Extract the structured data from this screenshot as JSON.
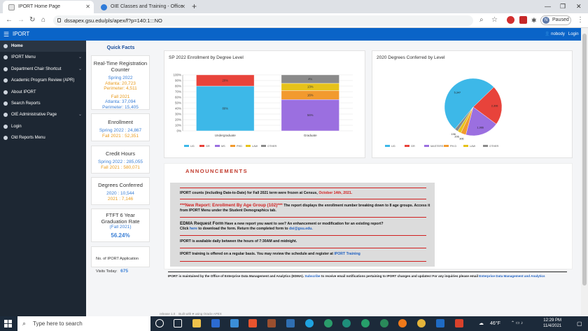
{
  "browser": {
    "tabs": [
      {
        "title": "IPORT Home Page",
        "active": true
      },
      {
        "title": "OIE Classes and Training - Office",
        "active": false
      }
    ],
    "new_tab": "+",
    "window_controls": [
      "—",
      "❐",
      "✕"
    ],
    "url": "dssapex.gsu.edu/pls/apex/f?p=140:1:::NO",
    "profile_initial": "N",
    "profile_status": "Paused"
  },
  "app": {
    "brand": "IPORT",
    "user": "nobody",
    "login_link": "Login"
  },
  "sidebar": {
    "items": [
      {
        "label": "Home",
        "has_chevron": false
      },
      {
        "label": "IPORT Menu",
        "has_chevron": true
      },
      {
        "label": "Department Chair Shortcut",
        "has_chevron": true
      },
      {
        "label": "Academic Program Review (APR)",
        "has_chevron": false
      },
      {
        "label": "About IPORT",
        "has_chevron": false
      },
      {
        "label": "Search Reports",
        "has_chevron": false
      },
      {
        "label": "OIE Administrative Page",
        "has_chevron": true
      },
      {
        "label": "Login",
        "has_chevron": false
      },
      {
        "label": "Old Reports Menu",
        "has_chevron": false
      }
    ]
  },
  "quick_facts": {
    "title": "Quick Facts",
    "registration": {
      "title": "Real-Time Registration Counter",
      "spring_heading": "Spring 2022",
      "spring_atlanta": "Atlanta: 20,723",
      "spring_perimeter": "Perimeter: 4,511",
      "fall_heading": "Fall 2021",
      "fall_atlanta": "Atlanta: 37,094",
      "fall_perimeter": "Perimeter: 15,405"
    },
    "enrollment": {
      "title": "Enrollment",
      "spring": "Spring 2022 : 24,867",
      "fall": "Fall 2021 : 52,351"
    },
    "credit_hours": {
      "title": "Credit Hours",
      "spring": "Spring 2022 : 285,055",
      "fall": "Fall 2021 : 580,071"
    },
    "degrees": {
      "title": "Degrees Conferred",
      "y2020": "2020 : 10,544",
      "y2021": "2021 : 7,146"
    },
    "ftft": {
      "title": "FTFT 6 Year Graduation Rate",
      "term": "(Fall 2021)",
      "value": "56.24%"
    },
    "visits": {
      "label": "No. of IPORT Application Visits Today:",
      "value": "675"
    }
  },
  "chart_data": [
    {
      "type": "bar",
      "stacked": true,
      "title": "SP 2022 Enrollment by Degree Level",
      "categories": [
        "Undergraduate",
        "Graduate"
      ],
      "y_ticks": [
        "100%",
        "90%",
        "80%",
        "70%",
        "60%",
        "50%",
        "40%",
        "30%",
        "20%",
        "10%",
        "0%"
      ],
      "ylim": [
        0,
        100
      ],
      "series": [
        {
          "name": "UG",
          "values": [
            80,
            0
          ],
          "labels": [
            "80%",
            ""
          ]
        },
        {
          "name": "GR",
          "values": [
            20,
            0
          ],
          "labels": [
            "20%",
            ""
          ]
        },
        {
          "name": "MS",
          "values": [
            0,
            56
          ],
          "labels": [
            "",
            "56%"
          ]
        },
        {
          "name": "PHD",
          "values": [
            0,
            16
          ],
          "labels": [
            "",
            "16%"
          ]
        },
        {
          "name": "LAW",
          "values": [
            0,
            13
          ],
          "labels": [
            "",
            "13%"
          ]
        },
        {
          "name": "OTHER",
          "values": [
            0,
            15
          ],
          "labels": [
            "",
            "4%"
          ]
        }
      ],
      "legend_position": "bottom",
      "grid": true
    },
    {
      "type": "pie",
      "title": "2020 Degrees Conferred by Level",
      "slices": [
        {
          "name": "UG",
          "value": 5347,
          "label": "5,347"
        },
        {
          "name": "GR",
          "value": 2306,
          "label": "2,306"
        },
        {
          "name": "MASTERS",
          "value": 1966,
          "label": "1,966"
        },
        {
          "name": "PH.D",
          "value": 306,
          "label": "306"
        },
        {
          "name": "LAW",
          "value": 206,
          "label": "206"
        },
        {
          "name": "OTHER",
          "value": 196,
          "label": "196"
        }
      ],
      "legend_position": "bottom"
    }
  ],
  "colors": {
    "UG": "#3db8e8",
    "GR": "#e8433b",
    "MS": "#9b6fe0",
    "PHD": "#f29a2e",
    "LAW": "#e6c21a",
    "OTHER": "#8a8a8a",
    "accent": "#0a64c8"
  },
  "announcements": {
    "title": "ANNOUNCEMENTS",
    "a1_text": "IPORT counts (including Date-to-Date) for Fall 2021 term were frozen at Census,",
    "a1_date": "October 14th, 2021.",
    "a2_heading": "***New Report: Enrollment By Age Group (102)***",
    "a2_text": "The report displays the enrollment number breaking down to 8 age groups. Access it from IPORT Menu under the Student Demographics tab.",
    "a3_heading": "EDMA Request Form",
    "a3_text": "Have a new report you want to see? An enhancement or modification for an existing report?",
    "a3_click": "Click",
    "a3_here": "here",
    "a3_rest": "to download the form. Return the completed form to",
    "a3_email": "dsi@gsu.edu.",
    "a4_text": "IPORT is available daily between the hours of 7:30AM and midnight.",
    "a5_text": "IPORT training is offered on a regular basis. You may review the schedule and register at",
    "a5_link": "IPORT Training"
  },
  "footer": {
    "maintained": "IPORT is maintained by the Office of Enterprise Data Management and Analytics (EDMA).",
    "subscribe": "Subscribe",
    "subscribe_rest": "to receive email notifications pertaining to IPORT changes and updates! For any inquiries please email",
    "edma_link": "Enterprise Data Management and Analytics",
    "release": "release 1.0",
    "built_with": "Built with ♥ using Oracle APEX"
  },
  "taskbar": {
    "search_placeholder": "Type here to search",
    "weather": "46°F",
    "time": "12:29 PM",
    "date": "11/4/2021"
  }
}
